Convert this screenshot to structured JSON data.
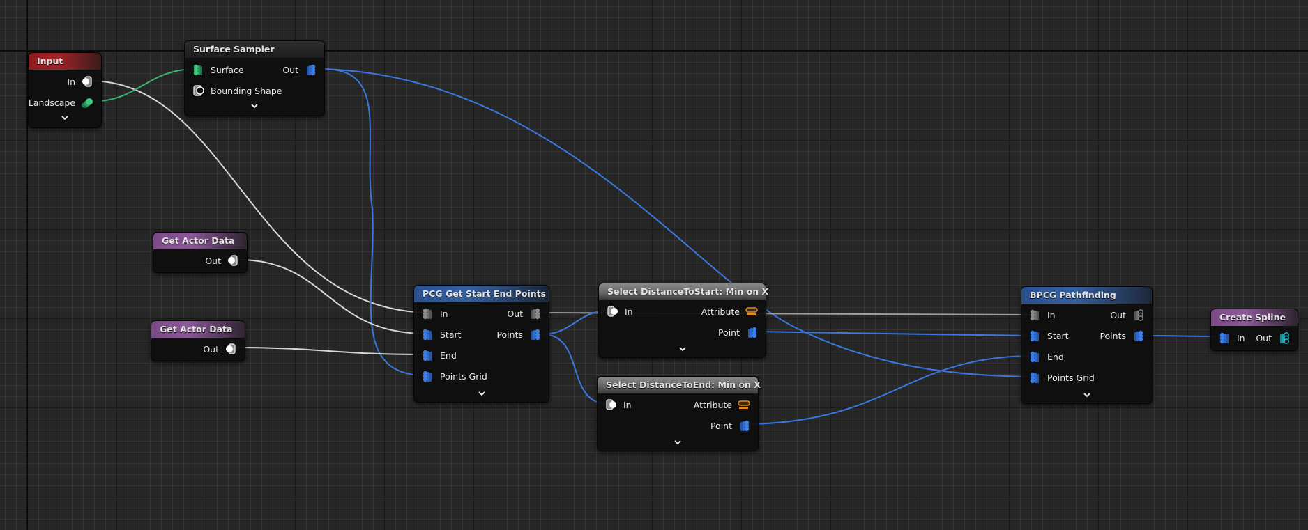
{
  "graph": {
    "nodes": {
      "input": {
        "title": "Input",
        "pins_out": [
          {
            "label": "In",
            "type": "any"
          },
          {
            "label": "Landscape",
            "type": "landscape"
          }
        ]
      },
      "surface_sampler": {
        "title": "Surface Sampler",
        "pins_in": [
          {
            "label": "Surface",
            "type": "surface"
          },
          {
            "label": "Bounding Shape",
            "type": "spatial"
          }
        ],
        "pins_out": [
          {
            "label": "Out",
            "type": "point"
          }
        ]
      },
      "get_actor_data_1": {
        "title": "Get Actor Data",
        "pins_out": [
          {
            "label": "Out",
            "type": "any"
          }
        ]
      },
      "get_actor_data_2": {
        "title": "Get Actor Data",
        "pins_out": [
          {
            "label": "Out",
            "type": "any"
          }
        ]
      },
      "pcg_get_start_end_points": {
        "title": "PCG Get Start End Points",
        "pins_in": [
          {
            "label": "In",
            "type": "any"
          },
          {
            "label": "Start",
            "type": "point"
          },
          {
            "label": "End",
            "type": "point"
          },
          {
            "label": "Points Grid",
            "type": "point"
          }
        ],
        "pins_out": [
          {
            "label": "Out",
            "type": "any"
          },
          {
            "label": "Points",
            "type": "point"
          }
        ]
      },
      "select_distance_to_start": {
        "title": "Select DistanceToStart: Min on X",
        "pins_in": [
          {
            "label": "In",
            "type": "any-single"
          }
        ],
        "pins_out": [
          {
            "label": "Attribute",
            "type": "attribute"
          },
          {
            "label": "Point",
            "type": "point"
          }
        ]
      },
      "select_distance_to_end": {
        "title": "Select DistanceToEnd: Min on X",
        "pins_in": [
          {
            "label": "In",
            "type": "any-single"
          }
        ],
        "pins_out": [
          {
            "label": "Attribute",
            "type": "attribute"
          },
          {
            "label": "Point",
            "type": "point"
          }
        ]
      },
      "bpcg_pathfinding": {
        "title": "BPCG Pathfinding",
        "pins_in": [
          {
            "label": "In",
            "type": "any"
          },
          {
            "label": "Start",
            "type": "point"
          },
          {
            "label": "End",
            "type": "point"
          },
          {
            "label": "Points Grid",
            "type": "point"
          }
        ],
        "pins_out": [
          {
            "label": "Out",
            "type": "any"
          },
          {
            "label": "Points",
            "type": "point"
          }
        ]
      },
      "create_spline": {
        "title": "Create Spline",
        "pins_in": [
          {
            "label": "In",
            "type": "point"
          }
        ],
        "pins_out": [
          {
            "label": "Out",
            "type": "spline"
          }
        ]
      }
    },
    "connections": [
      {
        "from": "input.In",
        "to": "pcg_get_start_end_points.In",
        "color": "white"
      },
      {
        "from": "input.Landscape",
        "to": "surface_sampler.Surface",
        "color": "green"
      },
      {
        "from": "surface_sampler.Out",
        "to": "pcg_get_start_end_points.Points Grid",
        "color": "blue"
      },
      {
        "from": "surface_sampler.Out",
        "to": "bpcg_pathfinding.Points Grid",
        "color": "blue"
      },
      {
        "from": "get_actor_data_1.Out",
        "to": "pcg_get_start_end_points.Start",
        "color": "white"
      },
      {
        "from": "get_actor_data_2.Out",
        "to": "pcg_get_start_end_points.End",
        "color": "white"
      },
      {
        "from": "pcg_get_start_end_points.Out",
        "to": "bpcg_pathfinding.In",
        "color": "gray"
      },
      {
        "from": "pcg_get_start_end_points.Points",
        "to": "select_distance_to_start.In",
        "color": "blue"
      },
      {
        "from": "pcg_get_start_end_points.Points",
        "to": "select_distance_to_end.In",
        "color": "blue"
      },
      {
        "from": "select_distance_to_start.Point",
        "to": "bpcg_pathfinding.Start",
        "color": "blue"
      },
      {
        "from": "select_distance_to_end.Point",
        "to": "bpcg_pathfinding.End",
        "color": "blue"
      },
      {
        "from": "bpcg_pathfinding.Points",
        "to": "create_spline.In",
        "color": "blue"
      }
    ],
    "colors": {
      "pin_point": "#3a78e0",
      "pin_landscape": "#3cb371",
      "pin_any": "#a0a0a0",
      "pin_attribute": "#e08a1c",
      "pin_spline": "#2cc0c8"
    }
  }
}
